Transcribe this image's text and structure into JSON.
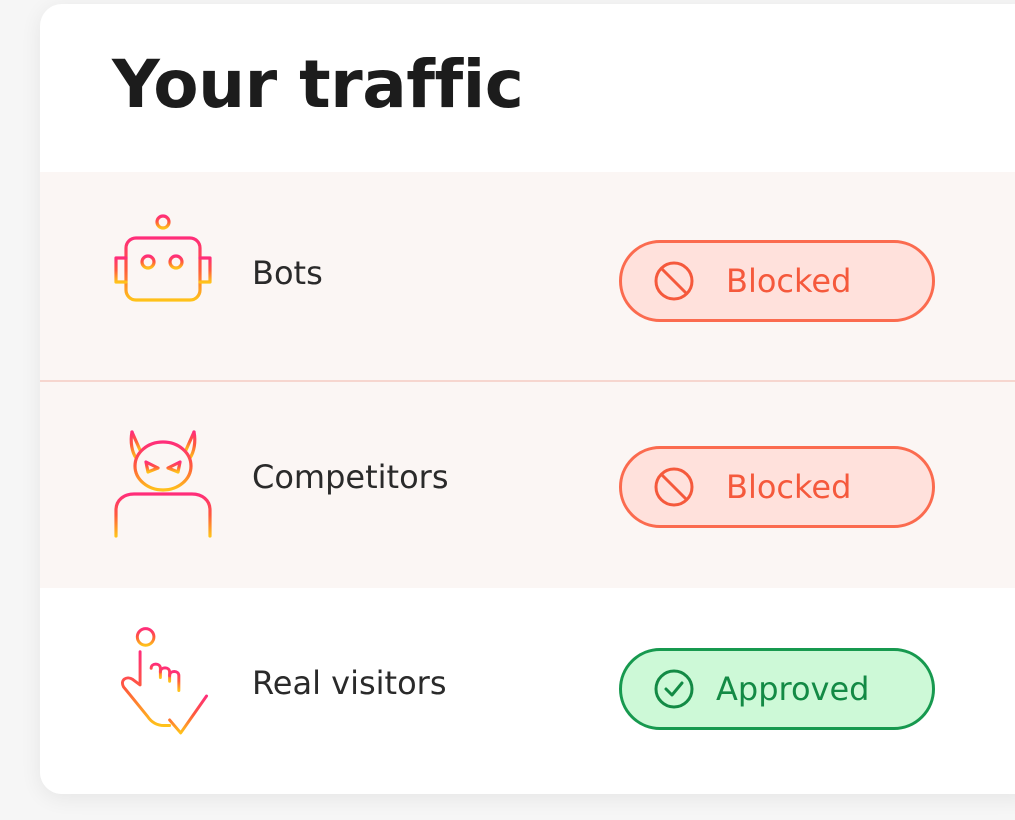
{
  "card": {
    "title": "Your traffic"
  },
  "rows": [
    {
      "label": "Bots",
      "icon": "robot-icon",
      "status": "Blocked",
      "status_icon": "prohibited-icon"
    },
    {
      "label": "Competitors",
      "icon": "devil-icon",
      "status": "Blocked",
      "status_icon": "prohibited-icon"
    },
    {
      "label": "Real visitors",
      "icon": "pointing-hand-check-icon",
      "status": "Approved",
      "status_icon": "check-circle-icon"
    }
  ],
  "colors": {
    "blocked_text": "#f5593c",
    "blocked_bg": "#ffe1dc",
    "approved_text": "#138a45",
    "approved_bg": "#cdf9d7",
    "icon_gradient_start": "#ff2d7a",
    "icon_gradient_end": "#ffc21a"
  }
}
